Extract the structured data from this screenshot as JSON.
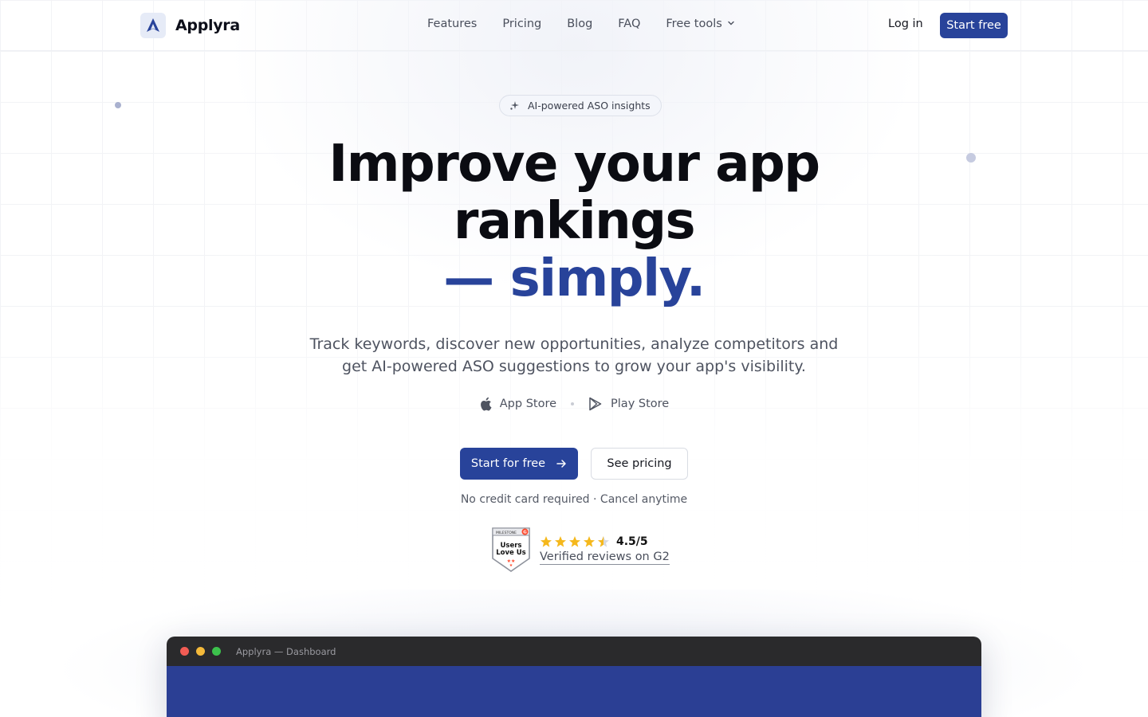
{
  "nav": {
    "brand": "Applyra",
    "links": [
      "Features",
      "Pricing",
      "Blog",
      "FAQ"
    ],
    "free_tools": "Free tools",
    "login": "Log in",
    "start_free": "Start free"
  },
  "hero": {
    "badge": "AI-powered ASO insights",
    "headline_line1": "Improve your app",
    "headline_line2": "rankings",
    "headline_accent": "— simply.",
    "subtitle": "Track keywords, discover new opportunities, analyze competitors and get AI-powered ASO suggestions to grow your app's visibility.",
    "stores": [
      "App Store",
      "Play Store"
    ],
    "cta_primary": "Start for free",
    "cta_secondary": "See pricing",
    "note": "No credit card required · Cancel anytime",
    "rating": "4.5/5",
    "rating_value": 4.5,
    "reviews_link": "Verified reviews on G2",
    "g2_badge_top": "MILESTONE",
    "g2_badge_text": "Users Love Us"
  },
  "preview": {
    "window_title": "Applyra — Dashboard"
  },
  "colors": {
    "brand": "#28439a",
    "text": "#0b0c12",
    "star": "#f5b81c"
  },
  "icons": [
    "logo-icon",
    "chevron-down-icon",
    "sparkle-icon",
    "apple-icon",
    "play-store-icon",
    "arrow-right-icon",
    "star-icon",
    "g2-badge-icon"
  ]
}
